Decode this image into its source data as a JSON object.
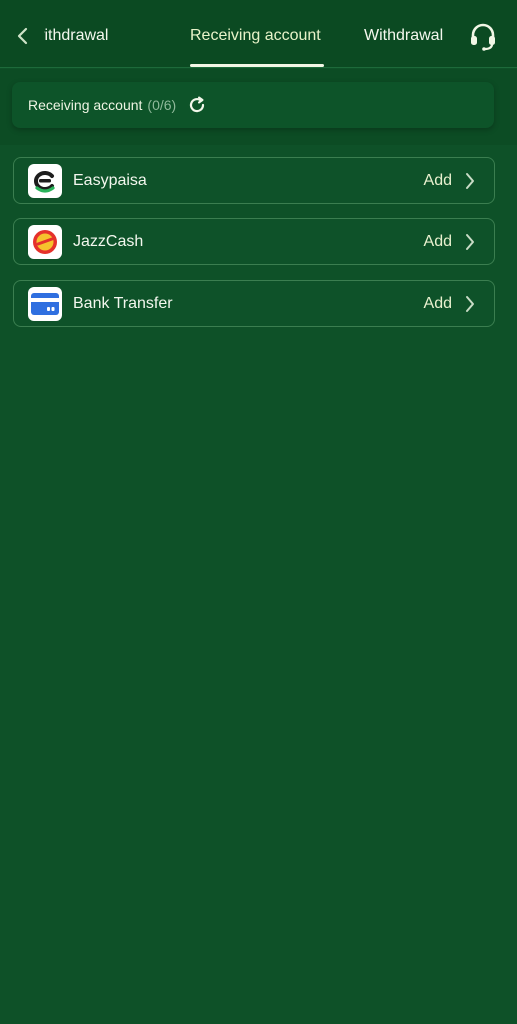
{
  "header": {
    "tabs": [
      {
        "label": "t withdrawal"
      },
      {
        "label": "Receiving account"
      },
      {
        "label": "Withdrawal"
      }
    ],
    "active_tab": "Receiving account"
  },
  "summary": {
    "label": "Receiving account",
    "count": "(0/6)"
  },
  "methods": [
    {
      "name": "Easypaisa",
      "action": "Add",
      "icon": "easypaisa-logo"
    },
    {
      "name": "JazzCash",
      "action": "Add",
      "icon": "jazzcash-logo"
    },
    {
      "name": "Bank Transfer",
      "action": "Add",
      "icon": "bank-card-icon"
    }
  ],
  "colors": {
    "background": "#0e5128",
    "accent": "#e8f3c9",
    "border": "#3b7e50"
  }
}
